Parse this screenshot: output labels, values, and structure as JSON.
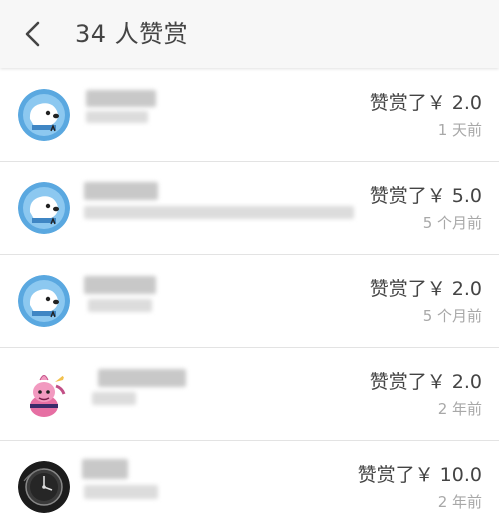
{
  "header": {
    "back_icon": "chevron-left-icon",
    "title": "34 人赞赏"
  },
  "rewards": [
    {
      "avatar": "blue-dog-avatar",
      "amount": "赞赏了￥ 2.0",
      "time": "1 天前"
    },
    {
      "avatar": "blue-dog-avatar",
      "amount": "赞赏了￥ 5.0",
      "time": "5 个月前"
    },
    {
      "avatar": "blue-dog-avatar",
      "amount": "赞赏了￥ 2.0",
      "time": "5 个月前"
    },
    {
      "avatar": "cartoon-character-avatar",
      "amount": "赞赏了￥ 2.0",
      "time": "2 年前"
    },
    {
      "avatar": "dark-watch-avatar",
      "amount": "赞赏了￥ 10.0",
      "time": "2 年前"
    }
  ],
  "colors": {
    "header_bg": "#f7f7f7",
    "text_primary": "#444444",
    "text_secondary": "#a8a8a8",
    "divider": "#e3e3e3",
    "avatar_blue": "#5aa8e0"
  }
}
